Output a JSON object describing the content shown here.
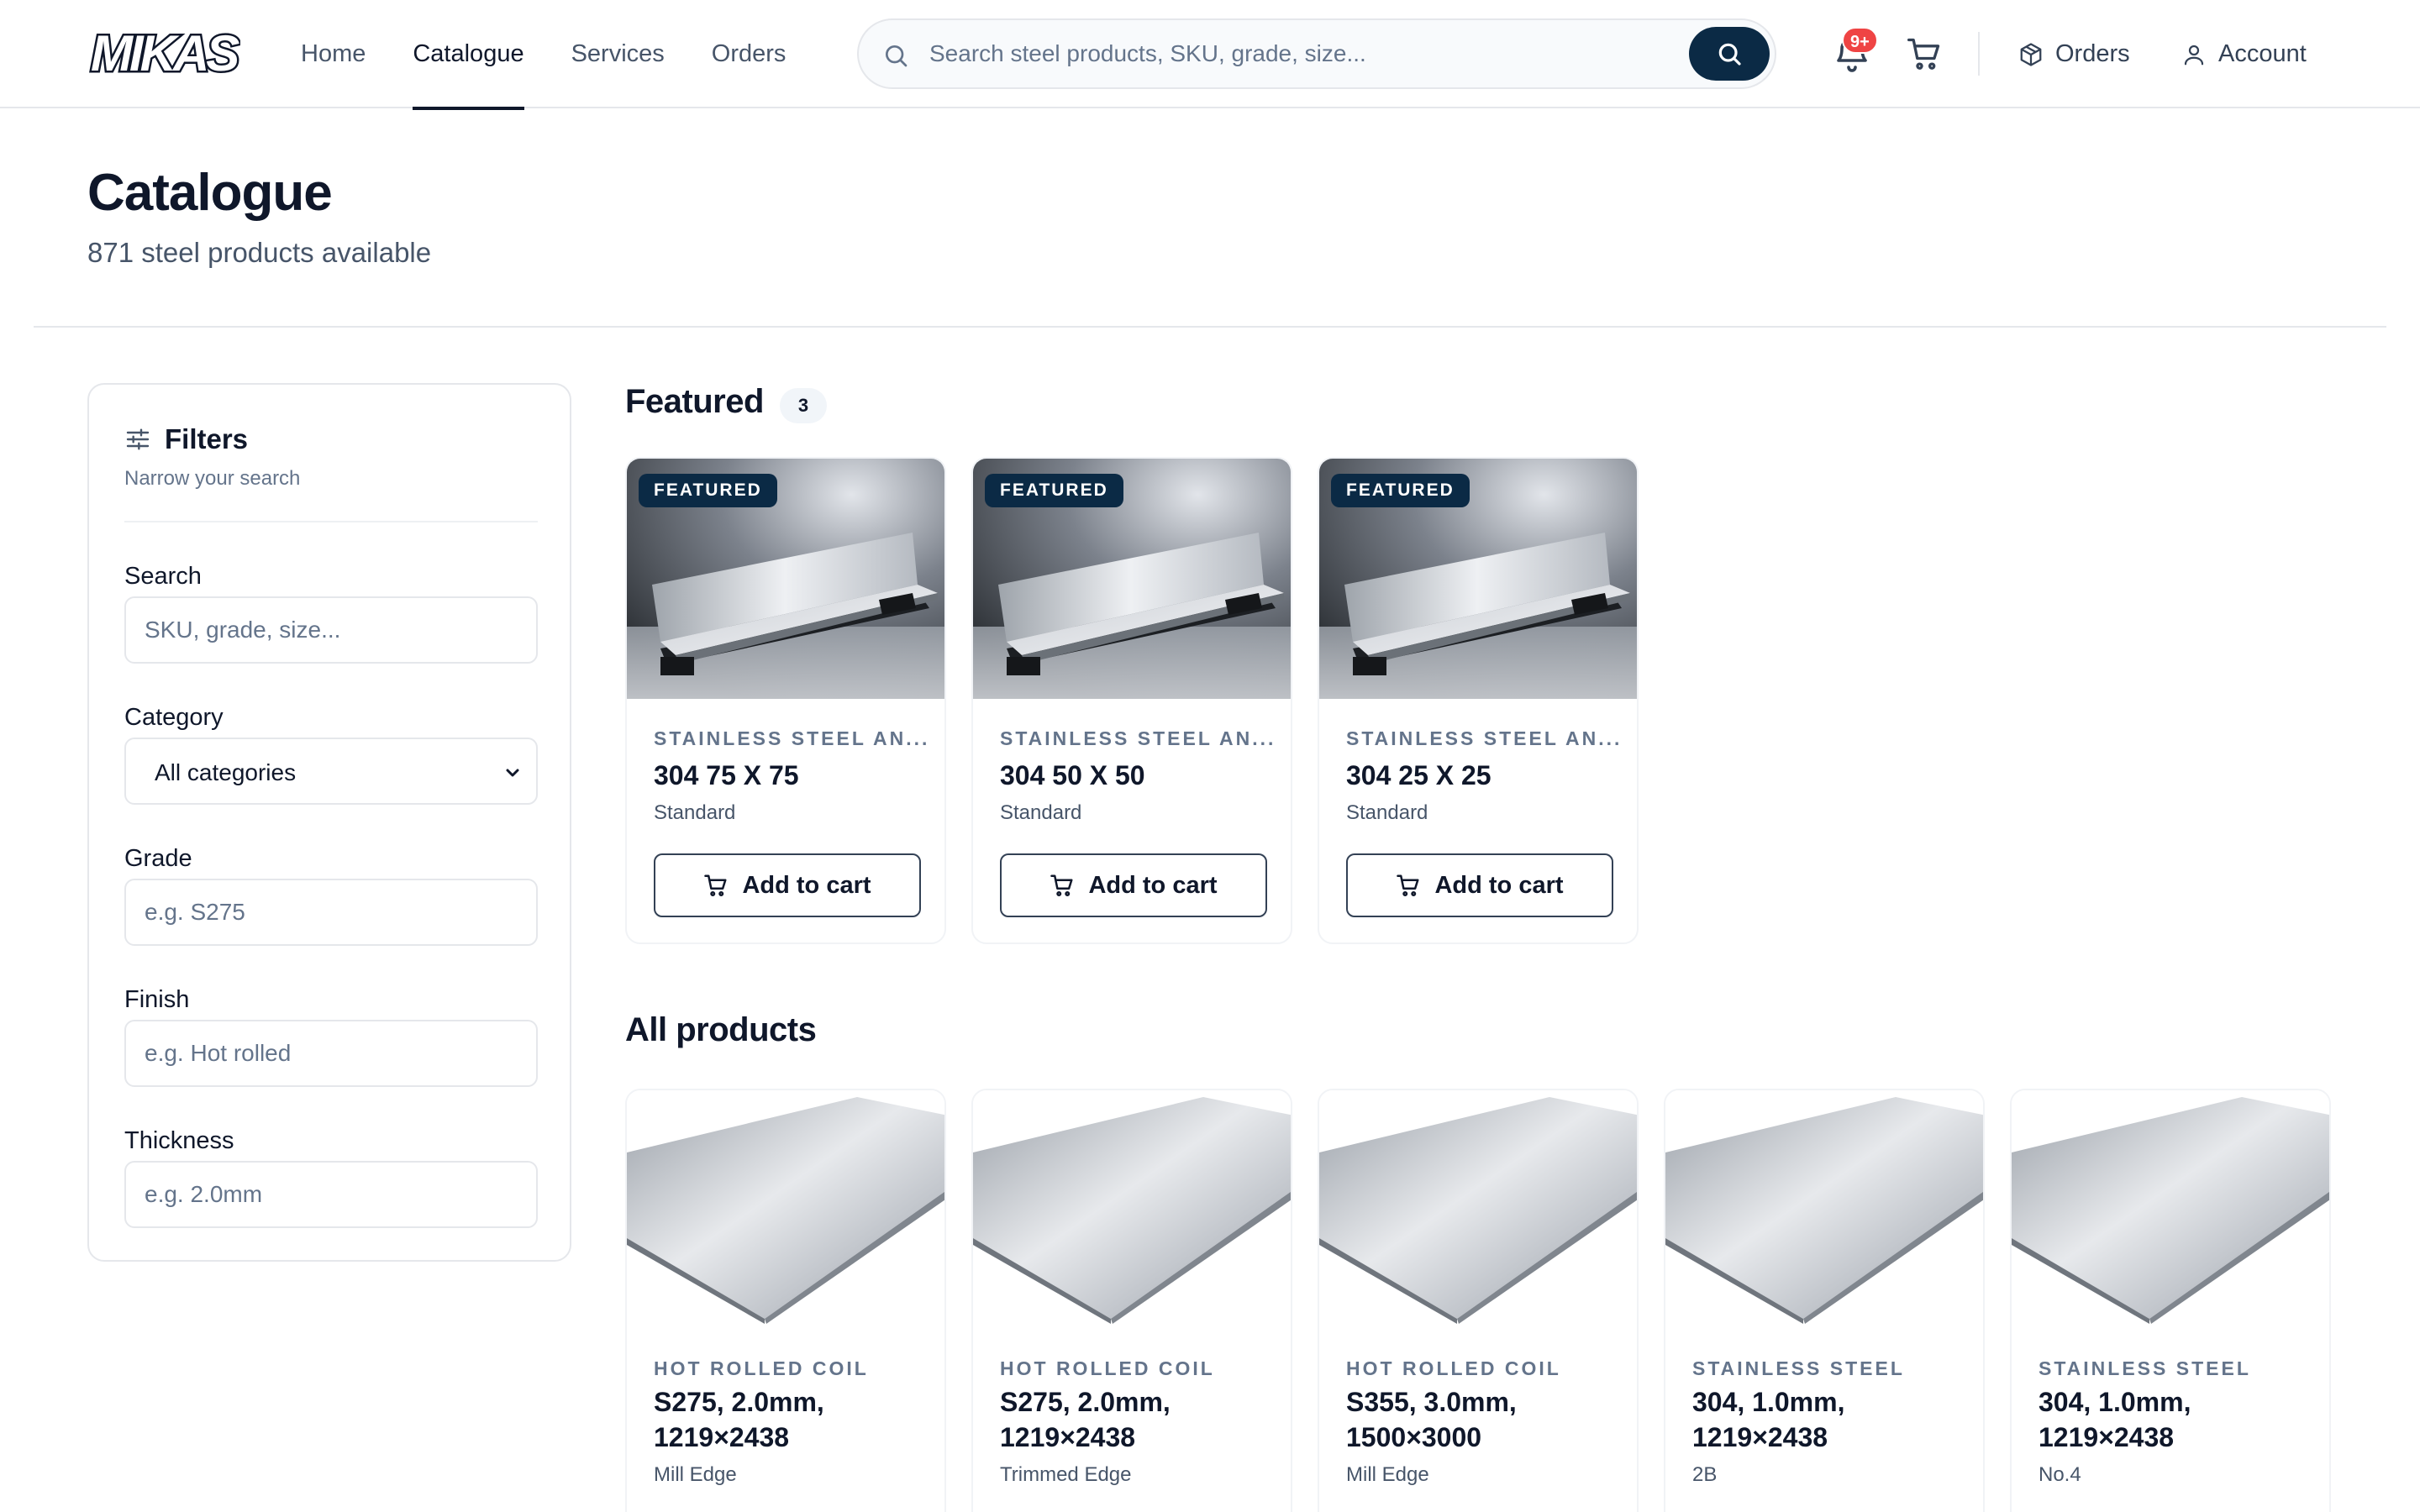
{
  "brand": {
    "logo_text": "MIKAS"
  },
  "nav": {
    "items": [
      "Home",
      "Catalogue",
      "Services",
      "Orders"
    ],
    "active": "Catalogue"
  },
  "search": {
    "placeholder": "Search steel products, SKU, grade, size..."
  },
  "notifications": {
    "badge": "9+"
  },
  "header_links": {
    "orders": "Orders",
    "account": "Account"
  },
  "page": {
    "title": "Catalogue",
    "subtitle": "871 steel products available"
  },
  "filters": {
    "title": "Filters",
    "subtitle": "Narrow your search",
    "search_label": "Search",
    "search_placeholder": "SKU, grade, size...",
    "category_label": "Category",
    "category_value": "All categories",
    "grade_label": "Grade",
    "grade_placeholder": "e.g. S275",
    "finish_label": "Finish",
    "finish_placeholder": "e.g. Hot rolled",
    "thickness_label": "Thickness",
    "thickness_placeholder": "e.g. 2.0mm"
  },
  "featured": {
    "title": "Featured",
    "count": "3",
    "tag": "FEATURED",
    "add_label": "Add to cart",
    "items": [
      {
        "category": "STAINLESS STEEL AN...",
        "name": "304 75 X 75",
        "finish": "Standard"
      },
      {
        "category": "STAINLESS STEEL AN...",
        "name": "304 50 X 50",
        "finish": "Standard"
      },
      {
        "category": "STAINLESS STEEL AN...",
        "name": "304 25 X 25",
        "finish": "Standard"
      }
    ]
  },
  "all_products": {
    "title": "All products",
    "items": [
      {
        "category": "HOT ROLLED COIL",
        "name": "S275, 2.0mm, 1219×2438",
        "finish": "Mill Edge"
      },
      {
        "category": "HOT ROLLED COIL",
        "name": "S275, 2.0mm, 1219×2438",
        "finish": "Trimmed Edge"
      },
      {
        "category": "HOT ROLLED COIL",
        "name": "S355, 3.0mm, 1500×3000",
        "finish": "Mill Edge"
      },
      {
        "category": "STAINLESS STEEL",
        "name": "304, 1.0mm, 1219×2438",
        "finish": "2B"
      },
      {
        "category": "STAINLESS STEEL",
        "name": "304, 1.0mm, 1219×2438",
        "finish": "No.4"
      }
    ]
  }
}
